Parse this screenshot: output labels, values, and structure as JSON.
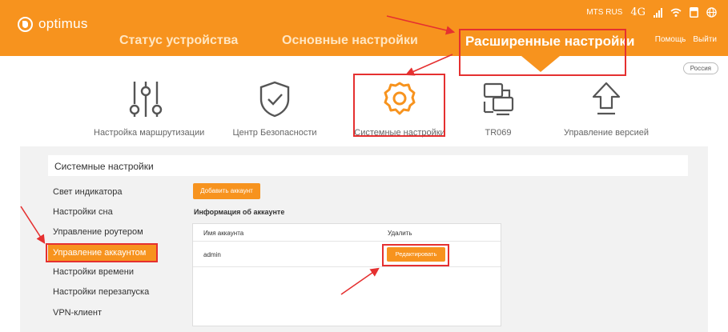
{
  "brand": {
    "name": "optimus"
  },
  "status": {
    "operator": "MTS RUS",
    "network": "4G"
  },
  "nav": {
    "items": [
      {
        "label": "Статус устройства"
      },
      {
        "label": "Основные настройки"
      },
      {
        "label": "Расширенные настройки"
      }
    ],
    "help": "Помощь",
    "logout": "Выйти"
  },
  "region": "Россия",
  "tiles": [
    {
      "label": "Настройка маршрутизации",
      "icon": "sliders-icon"
    },
    {
      "label": "Центр Безопасности",
      "icon": "shield-check-icon"
    },
    {
      "label": "Системные настройки",
      "icon": "gear-icon"
    },
    {
      "label": "TR069",
      "icon": "devices-icon"
    },
    {
      "label": "Управление версией",
      "icon": "upload-arrow-icon"
    }
  ],
  "panel": {
    "title": "Системные настройки",
    "sidebar": [
      {
        "label": "Свет индикатора"
      },
      {
        "label": "Настройки сна"
      },
      {
        "label": "Управление роутером"
      },
      {
        "label": "Управление аккаунтом"
      },
      {
        "label": "Настройки времени"
      },
      {
        "label": "Настройки перезапуска"
      },
      {
        "label": "VPN-клиент"
      }
    ],
    "add_button": "Добавить аккаунт",
    "account_info": "Информация об аккаунте",
    "table": {
      "columns": [
        "Имя аккаунта",
        "Удалить"
      ],
      "rows": [
        {
          "name": "admin",
          "action": "Редактировать"
        }
      ]
    }
  },
  "colors": {
    "accent": "#f7931e",
    "annotation": "#e53030"
  }
}
